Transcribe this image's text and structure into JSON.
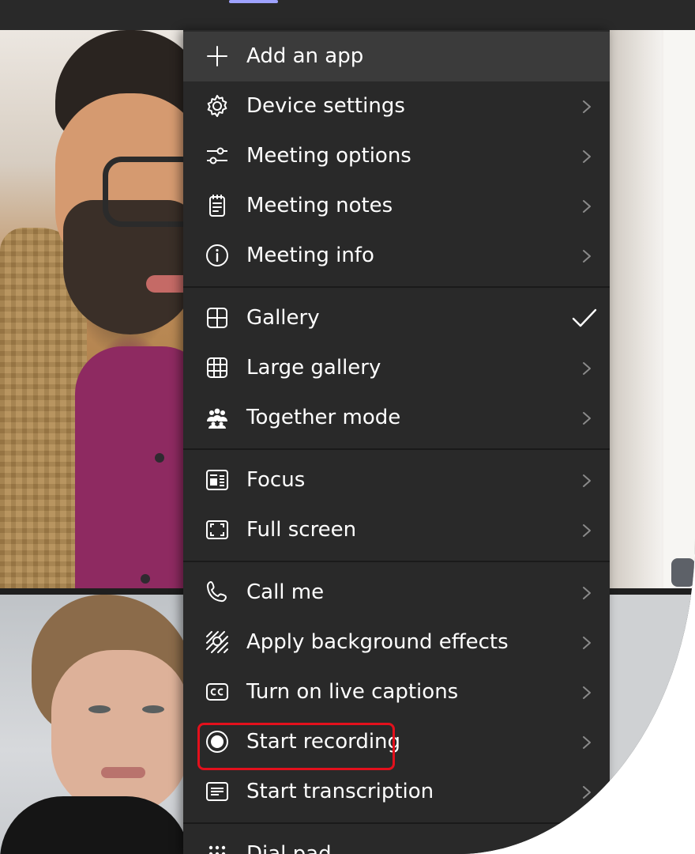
{
  "menu": {
    "groups": [
      [
        {
          "label": "Add an app",
          "icon": "add-icon",
          "chevron": false,
          "checked": false
        },
        {
          "label": "Device settings",
          "icon": "gear-icon",
          "chevron": true,
          "checked": false
        },
        {
          "label": "Meeting options",
          "icon": "sliders-icon",
          "chevron": true,
          "checked": false
        },
        {
          "label": "Meeting notes",
          "icon": "notes-icon",
          "chevron": true,
          "checked": false
        },
        {
          "label": "Meeting info",
          "icon": "info-icon",
          "chevron": true,
          "checked": false
        }
      ],
      [
        {
          "label": "Gallery",
          "icon": "gallery-icon",
          "chevron": false,
          "checked": true
        },
        {
          "label": "Large gallery",
          "icon": "large-gallery-icon",
          "chevron": true,
          "checked": false
        },
        {
          "label": "Together mode",
          "icon": "people-icon",
          "chevron": true,
          "checked": false
        }
      ],
      [
        {
          "label": "Focus",
          "icon": "focus-icon",
          "chevron": true,
          "checked": false
        },
        {
          "label": "Full screen",
          "icon": "fullscreen-icon",
          "chevron": true,
          "checked": false
        }
      ],
      [
        {
          "label": "Call me",
          "icon": "phone-icon",
          "chevron": true,
          "checked": false
        },
        {
          "label": "Apply background effects",
          "icon": "background-effects-icon",
          "chevron": true,
          "checked": false
        },
        {
          "label": "Turn on live captions",
          "icon": "captions-icon",
          "chevron": true,
          "checked": false
        },
        {
          "label": "Start recording",
          "icon": "record-icon",
          "chevron": true,
          "checked": false,
          "highlighted": true
        },
        {
          "label": "Start transcription",
          "icon": "transcript-icon",
          "chevron": true,
          "checked": false
        }
      ],
      [
        {
          "label": "Dial pad",
          "icon": "dialpad-icon",
          "chevron": false,
          "checked": false
        }
      ]
    ]
  },
  "colors": {
    "menu_bg": "#292929",
    "hover_bg": "#3b3b3b",
    "text": "#ffffff",
    "highlight_border": "#e3101c",
    "active_tab": "#9ea2ff"
  }
}
